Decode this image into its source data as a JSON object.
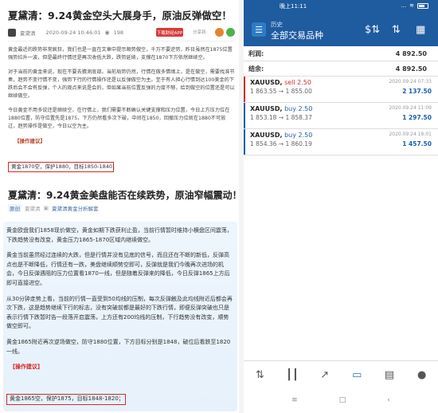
{
  "article1": {
    "title": "夏黛清：9.24黄金空头大展身手，原油反弹做空！",
    "author": "夏黛清",
    "datetime": "2020-09-24 10:46:01",
    "views": "198",
    "app_button": "下载财经APP",
    "share_label": "分享到:",
    "paragraphs": [
      "黄金最近的跌势非常疯狂，我们也是一直在文章中提示顺势做空，千万不要逆势，昨日虽然在1875位置强势拉升一波，但是最终行情还是再次收低大跌，跌势延续，支撑在1870下方依然继续空。",
      "对于当前的黄金来说，现在不要去猜测底部。当前局势仍然，行情在做多情绪上，是在做空，需要找准节奏，趋势不变行情不变，强势下行的行情操作还是以反弹做空为主。至于有人担心行情到达100美金的下跌后会不会有反弹，个人的观点来说是会的，但如果当前位置反弹的力度不够，给到做空的位置还是可以继续做空。",
      "今日黄金不用多说还是继续空，在行情上，我们需要不断确认关键支撑和压力位置，今日上方压力位在1880位置，防守位置先是1875，下方仍然看多次下破，中间在1850，回撤压力位就在1880不可放过，趋势操作是做空，今日以空为主。"
    ],
    "op_header": "【操作建议】",
    "op_advice": "黄金1870空，保护1880，目标1850-1840；"
  },
  "article2": {
    "title": "夏黛清：9.24黄金美盘能否在续跌势，原油窄幅震动！",
    "tag1": "原创",
    "author": "夏黛清",
    "column": "夏黛清黄金分析解套",
    "paragraphs": [
      "黄金欧盘我们1858现价做空，黄金如期下跌获利止盈，当前行情暂时维持小横盘区间震荡，下跌趋势没有改变，黄金压力1865-1870区域内继续做空。",
      "黄金当前虽然经过连续的大跌，但是行情并没有见底的信号，而且还在不断的新低，反弹高点也是不断降低，行情还有一跌，美盘继续顺势空即可，反弹就是我们今晚再次进场的机会，今日反弹遇阻的压力位置看1870一线，但是随着反弹来的降低，今日反弹1865上方后即可直接进空。",
      "从30分钟走势上看，当前的行情一直受到50均线的压制，每次反弹触及此均线附近后都会再次下跌，这是趋势继续下行的标志，没有突破前都是最好的下跌行情，即便反弹突破也只是表示行情下跌暂时告一段落开启震荡，上方还有200均线的压制，下行趋势没有改变，顺势做空即可。",
      "黄金1865附近再次逆场做空，防守1880位置，下方目标分别是1848，破位后看跌至1820一线。"
    ],
    "op_header": "【操作建议】",
    "op_advice": "黄金1865空，保护1875，目标1848-1820；"
  },
  "phone": {
    "status_time": "晚上11:11",
    "status_net": "...",
    "status_wifi": "≋",
    "battery_pct": 0.6,
    "header_sub": "历史",
    "header_title": "全部交易品种",
    "summary": [
      {
        "label": "利润:",
        "value": "4 892.50"
      },
      {
        "label": "结余:",
        "value": "4 892.50"
      }
    ],
    "orders": [
      {
        "symbol": "XAUUSD,",
        "side": "sell 2.50",
        "prices": "1 863.55 → 1 855.00",
        "time": "2020.09.24 07:33",
        "profit": "2 137.50",
        "accent": "#d62a2a"
      },
      {
        "symbol": "XAUUSD,",
        "side": "buy 2.50",
        "prices": "1 853.18 → 1 858.37",
        "time": "2020.09.24 11:09",
        "profit": "1 297.50",
        "accent": "#1d5db3"
      },
      {
        "symbol": "XAUUSD,",
        "side": "buy 2.50",
        "prices": "1 854.36 → 1 860.19",
        "time": "2020.09.24 18:01",
        "profit": "1 457.50",
        "accent": "#1d5db3"
      }
    ],
    "nav_icons": [
      "quote-icon",
      "chart-candles-icon",
      "trend-icon",
      "inbox-icon",
      "news-icon",
      "chat-icon"
    ]
  },
  "colors": {
    "header_blue": "#1f5b9f",
    "sell_red": "#d62a2a",
    "buy_blue": "#1d5db3",
    "op_box_red": "#d62a2a"
  }
}
